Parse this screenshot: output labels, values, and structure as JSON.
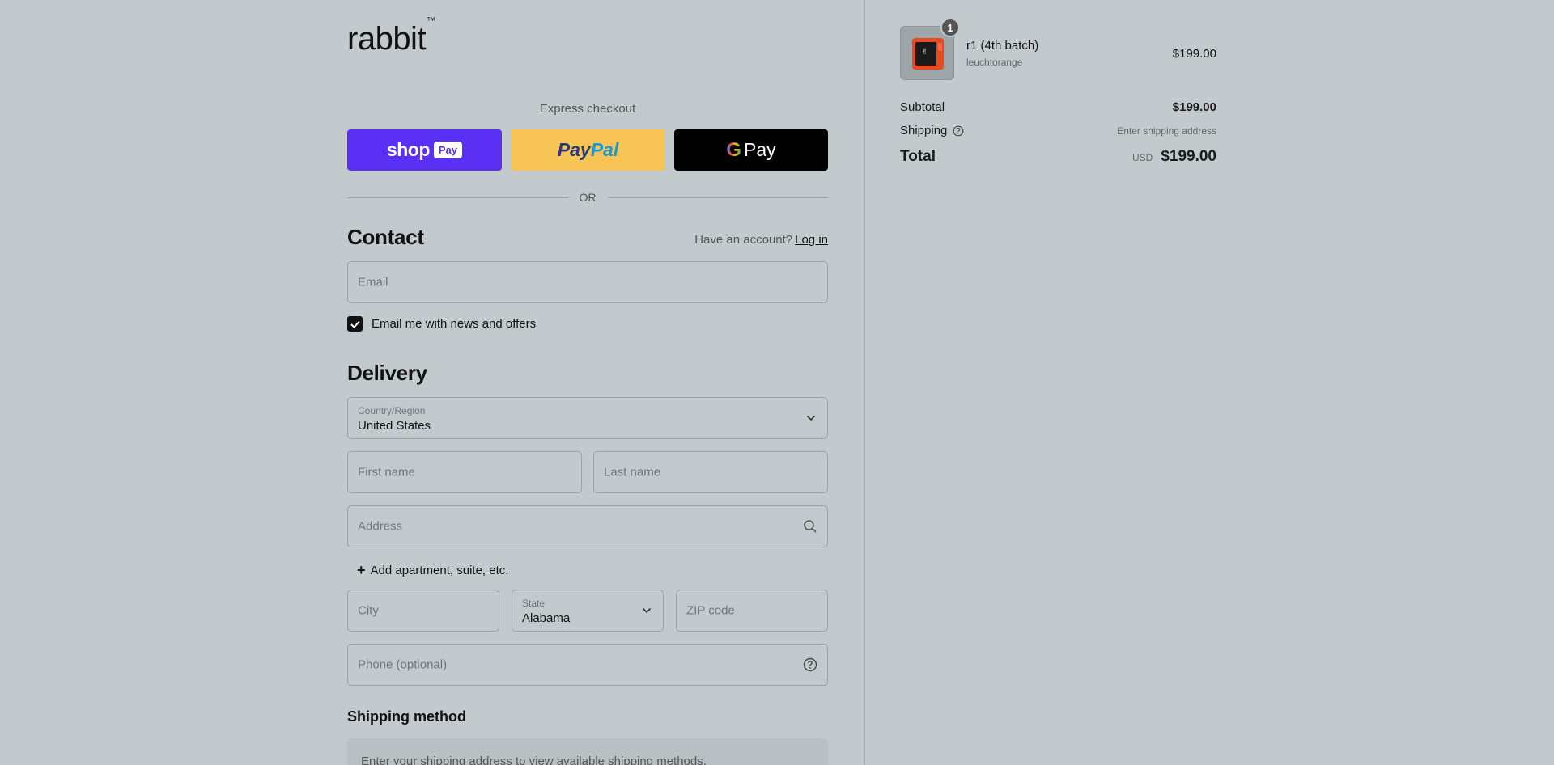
{
  "brand": {
    "logo_text": "rabbit",
    "logo_tm": "™"
  },
  "express": {
    "label": "Express checkout",
    "shoppay": {
      "shop": "shop",
      "pay": "Pay"
    },
    "paypal": {
      "pay": "Pay",
      "pal": "Pal"
    },
    "gpay": {
      "g": "G",
      "pay": "Pay"
    }
  },
  "or_text": "OR",
  "contact": {
    "heading": "Contact",
    "have_account": "Have an account?",
    "login": "Log in",
    "email_placeholder": "Email",
    "newsletter_label": "Email me with news and offers",
    "newsletter_checked": true
  },
  "delivery": {
    "heading": "Delivery",
    "country_label": "Country/Region",
    "country_value": "United States",
    "first_name_placeholder": "First name",
    "last_name_placeholder": "Last name",
    "address_placeholder": "Address",
    "add_apartment": "Add apartment, suite, etc.",
    "city_placeholder": "City",
    "state_label": "State",
    "state_value": "Alabama",
    "zip_placeholder": "ZIP code",
    "phone_placeholder": "Phone (optional)"
  },
  "shipping_method": {
    "heading": "Shipping method",
    "notice": "Enter your shipping address to view available shipping methods."
  },
  "summary": {
    "item": {
      "name": "r1 (4th batch)",
      "variant": "leuchtorange",
      "price": "$199.00",
      "quantity": "1"
    },
    "subtotal_label": "Subtotal",
    "subtotal_value": "$199.00",
    "shipping_label": "Shipping",
    "shipping_value": "Enter shipping address",
    "total_label": "Total",
    "currency": "USD",
    "total_value": "$199.00"
  },
  "colors": {
    "background": "#c3cacd",
    "shoppay": "#5a31f4",
    "paypal": "#f9c456",
    "gpay": "#000000",
    "device": "#e8491d"
  }
}
